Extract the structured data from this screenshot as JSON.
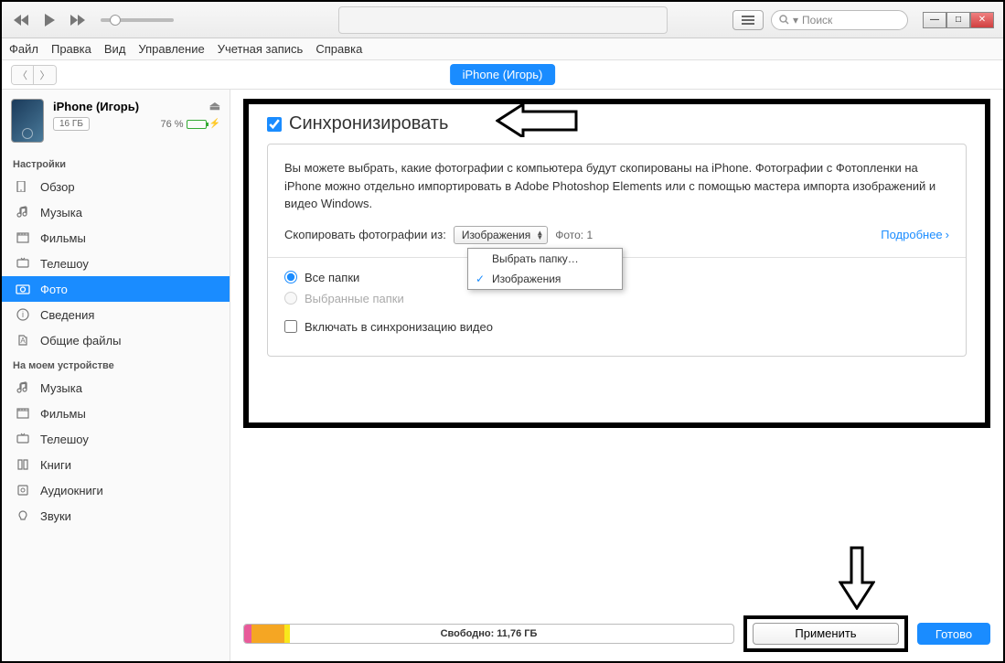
{
  "toolbar": {
    "search_placeholder": "Поиск"
  },
  "menu": {
    "file": "Файл",
    "edit": "Правка",
    "view": "Вид",
    "controls": "Управление",
    "account": "Учетная запись",
    "help": "Справка"
  },
  "device_tab": "iPhone (Игорь)",
  "device": {
    "name": "iPhone (Игорь)",
    "storage": "16 ГБ",
    "battery_percent": "76 %"
  },
  "sidebar": {
    "settings_title": "Настройки",
    "settings": [
      {
        "label": "Обзор"
      },
      {
        "label": "Музыка"
      },
      {
        "label": "Фильмы"
      },
      {
        "label": "Телешоу"
      },
      {
        "label": "Фото"
      },
      {
        "label": "Сведения"
      },
      {
        "label": "Общие файлы"
      }
    ],
    "ondevice_title": "На моем устройстве",
    "ondevice": [
      {
        "label": "Музыка"
      },
      {
        "label": "Фильмы"
      },
      {
        "label": "Телешоу"
      },
      {
        "label": "Книги"
      },
      {
        "label": "Аудиокниги"
      },
      {
        "label": "Звуки"
      }
    ]
  },
  "content": {
    "sync_title": "Синхронизировать",
    "description": "Вы можете выбрать, какие фотографии с компьютера будут скопированы на iPhone. Фотографии с Фотопленки на iPhone можно отдельно импортировать в Adobe Photoshop Elements или с помощью мастера импорта изображений и видео Windows.",
    "copy_label": "Скопировать фотографии из:",
    "dropdown_selected": "Изображения",
    "dropdown_options": [
      "Выбрать папку…",
      "Изображения"
    ],
    "photo_count": "Фото: 1",
    "more_link": "Подробнее",
    "radio_all": "Все папки",
    "radio_selected": "Выбранные папки",
    "include_video": "Включать в синхронизацию видео"
  },
  "bottom": {
    "free_space": "Свободно: 11,76 ГБ",
    "apply": "Применить",
    "done": "Готово"
  }
}
